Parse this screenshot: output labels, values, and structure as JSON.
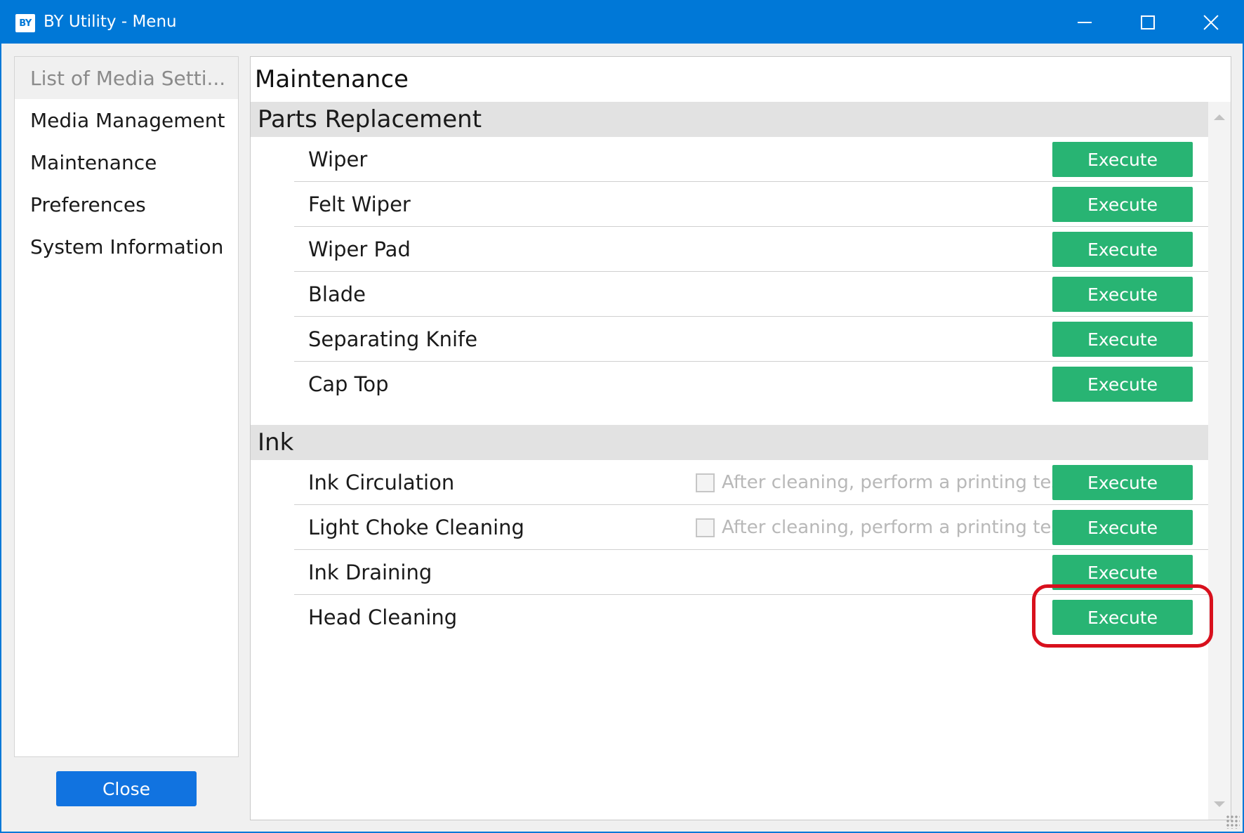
{
  "window": {
    "app_icon": "BY",
    "title": "BY Utility - Menu"
  },
  "sidebar": {
    "items": [
      {
        "label": "List of Media Setti...",
        "enabled": false
      },
      {
        "label": "Media Management",
        "enabled": true
      },
      {
        "label": "Maintenance",
        "enabled": true
      },
      {
        "label": "Preferences",
        "enabled": true
      },
      {
        "label": "System Information",
        "enabled": true
      }
    ],
    "close_label": "Close"
  },
  "main": {
    "title": "Maintenance",
    "sections": [
      {
        "header": "Parts Replacement",
        "rows": [
          {
            "label": "Wiper",
            "button": "Execute"
          },
          {
            "label": "Felt Wiper",
            "button": "Execute"
          },
          {
            "label": "Wiper Pad",
            "button": "Execute"
          },
          {
            "label": "Blade",
            "button": "Execute"
          },
          {
            "label": "Separating Knife",
            "button": "Execute"
          },
          {
            "label": "Cap Top",
            "button": "Execute"
          }
        ]
      },
      {
        "header": "Ink",
        "rows": [
          {
            "label": "Ink Circulation",
            "option": "After cleaning, perform a printing test",
            "option_checked": false,
            "option_enabled": false,
            "button": "Execute"
          },
          {
            "label": "Light Choke Cleaning",
            "option": "After cleaning, perform a printing test",
            "option_checked": false,
            "option_enabled": false,
            "button": "Execute"
          },
          {
            "label": "Ink Draining",
            "button": "Execute"
          },
          {
            "label": "Head Cleaning",
            "button": "Execute",
            "highlighted": true
          }
        ]
      }
    ]
  },
  "colors": {
    "titlebar": "#0078d7",
    "execute_button": "#28b473",
    "close_button": "#1173e0",
    "highlight": "#d8101d"
  },
  "icons": [
    "app-logo-icon",
    "minimize-icon",
    "maximize-icon",
    "close-icon",
    "scroll-up-icon",
    "scroll-down-icon",
    "resize-grip-icon"
  ]
}
